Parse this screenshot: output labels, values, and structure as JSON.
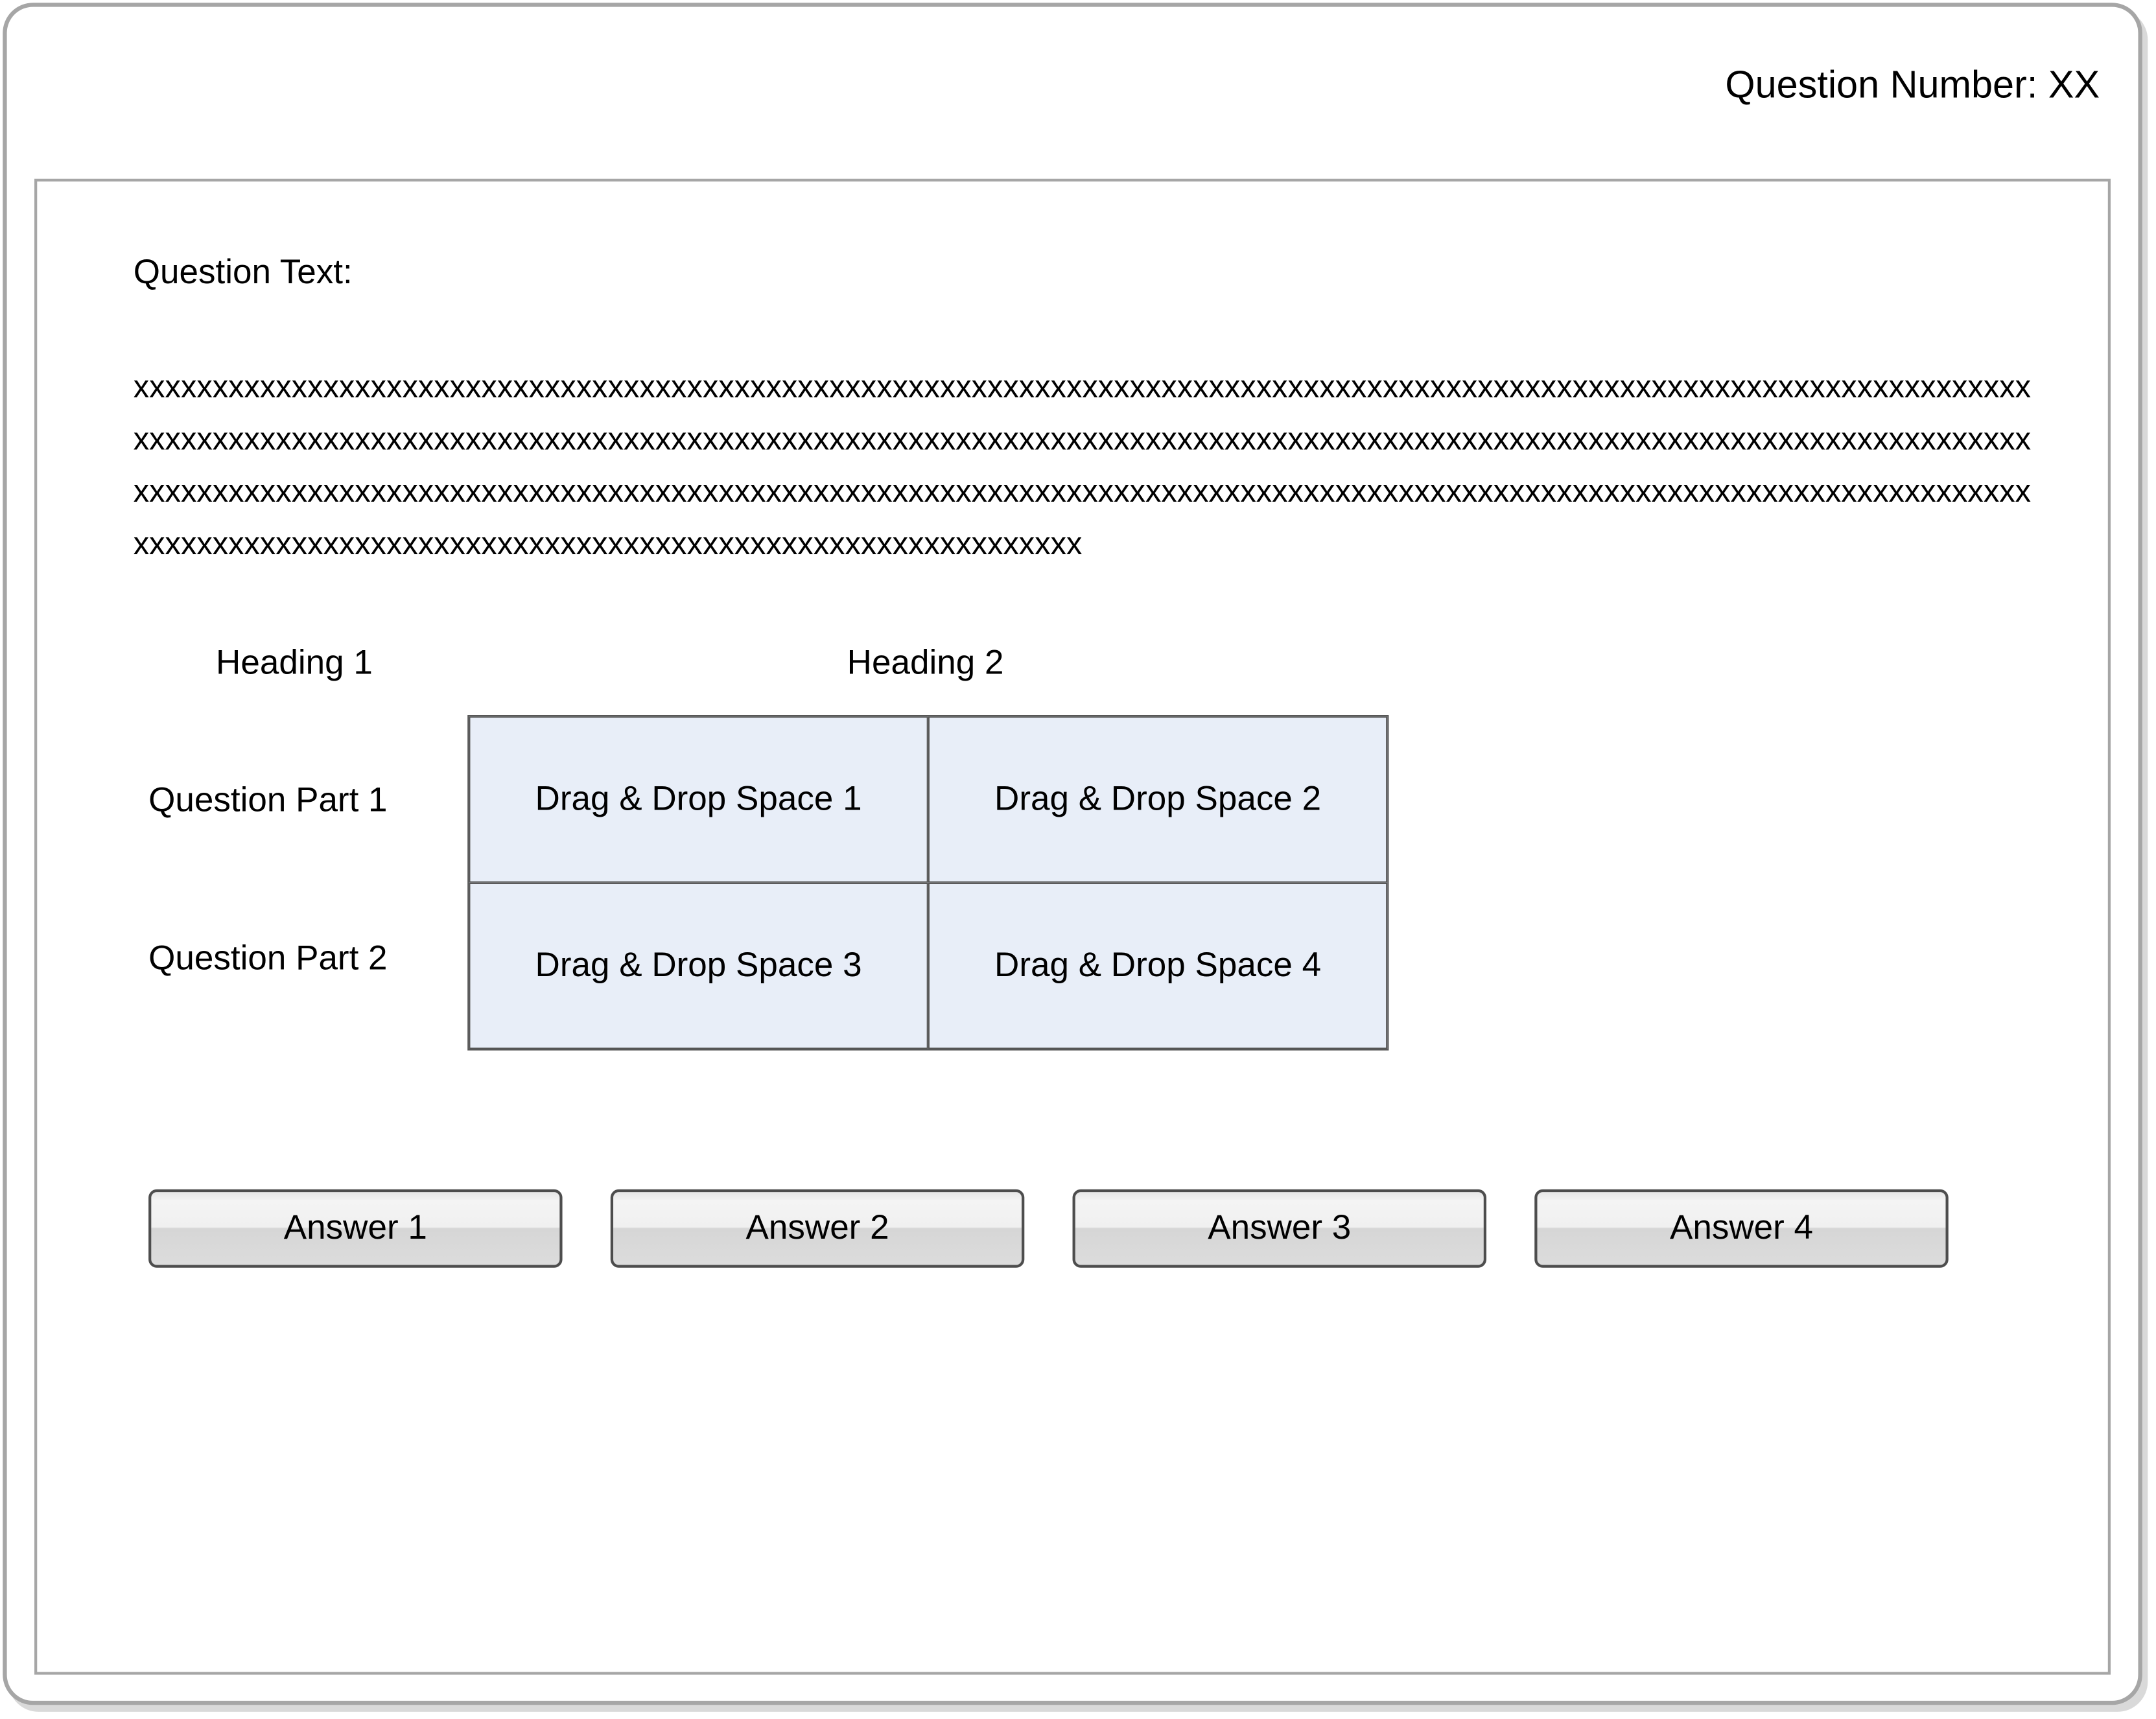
{
  "header": {
    "question_number": "Question Number: XX"
  },
  "question": {
    "label": "Question Text:",
    "text": "xxxxxxxxxxxxxxxxxxxxxxxxxxxxxxxxxxxxxxxxxxxxxxxxxxxxxxxxxxxxxxxxxxxxxxxxxxxxxxxxxxxxxxxxxxxxxxxxxxxxxxxxxxxxxxxxxxxxxxxxxxxxxxxxxxxxxxxxxxxxxxxxxxxxxxxxxxxxxxxxxxxxxxxxxxxxxxxxxxxxxxxxxxxxxxxxxxxxxxxxxxxxxxxxxxxxxxxxxxxxxxxxxxxxxxxxxxxxxxxxxxxxxxxxxxxxxxxxxxxxxxxxxxxxxxxxxxxxxxxxxxxxxxxxxxxxxxxxxxxxxxxxxxxxxxxxxxxxxxxxxxxxxxxxxxxxxxxxxxxxxxxxxxxxxxxxxxxxxxxxxxxxxxxxxxxxxxxxxxxxxxxxxxxxxxxxxxxxxxxxxxxxxxxxxxxxxxxxxxxx"
  },
  "table": {
    "headings": [
      "Heading 1",
      "Heading 2"
    ],
    "rows": [
      "Question Part 1",
      "Question Part 2"
    ],
    "spaces": [
      "Drag & Drop Space 1",
      "Drag & Drop Space 2",
      "Drag & Drop Space 3",
      "Drag & Drop Space 4"
    ]
  },
  "answers": [
    "Answer 1",
    "Answer 2",
    "Answer 3",
    "Answer 4"
  ],
  "colors": {
    "drop_space_fill": "#e8eef8",
    "frame_border": "#a6a6a6",
    "button_border": "#4d4d4d"
  }
}
